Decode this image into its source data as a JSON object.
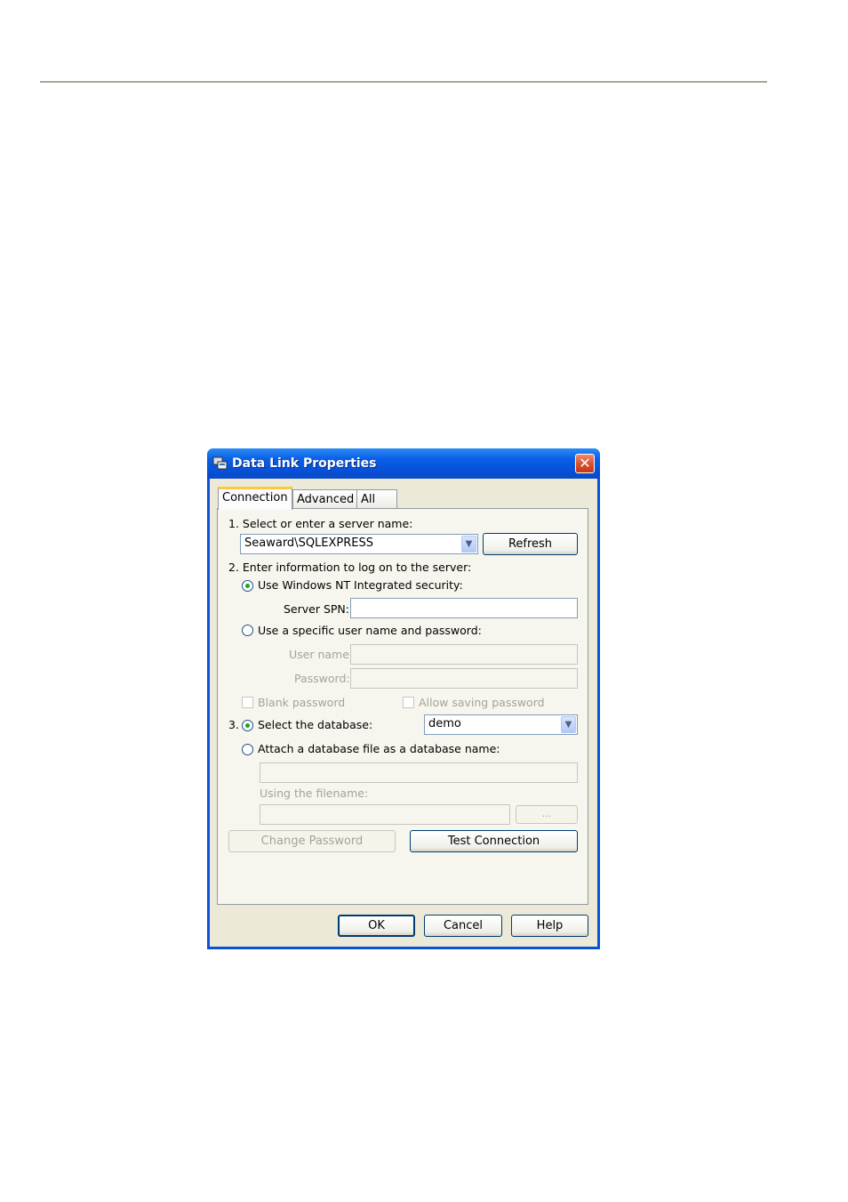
{
  "dialog": {
    "title": "Data Link Properties",
    "close_symbol": "✕"
  },
  "tabs": [
    "Connection",
    "Advanced",
    "All"
  ],
  "step1": {
    "label": "1. Select or enter a server name:",
    "server_value": "Seaward\\SQLEXPRESS",
    "refresh_label": "Refresh"
  },
  "step2": {
    "label": "2. Enter information to log on to the server:",
    "windows_nt_label": "Use Windows NT Integrated security:",
    "server_spn_label": "Server SPN:",
    "server_spn_value": "",
    "specific_user_label": "Use a specific user name and password:",
    "user_name_label": "User name:",
    "password_label": "Password:",
    "blank_password_label": "Blank password",
    "allow_saving_label": "Allow saving password"
  },
  "step3": {
    "number": "3.",
    "select_db_label": "Select the database:",
    "database_value": "demo",
    "attach_label": "Attach a database file as a database name:",
    "filename_label": "Using the filename:",
    "browse_label": "..."
  },
  "buttons": {
    "change_password": "Change Password",
    "test_connection": "Test Connection",
    "ok": "OK",
    "cancel": "Cancel",
    "help": "Help"
  },
  "colors": {
    "titlebar": "#0a53d8",
    "dialog_face": "#ece9d8",
    "radio_dot": "#21a121"
  }
}
